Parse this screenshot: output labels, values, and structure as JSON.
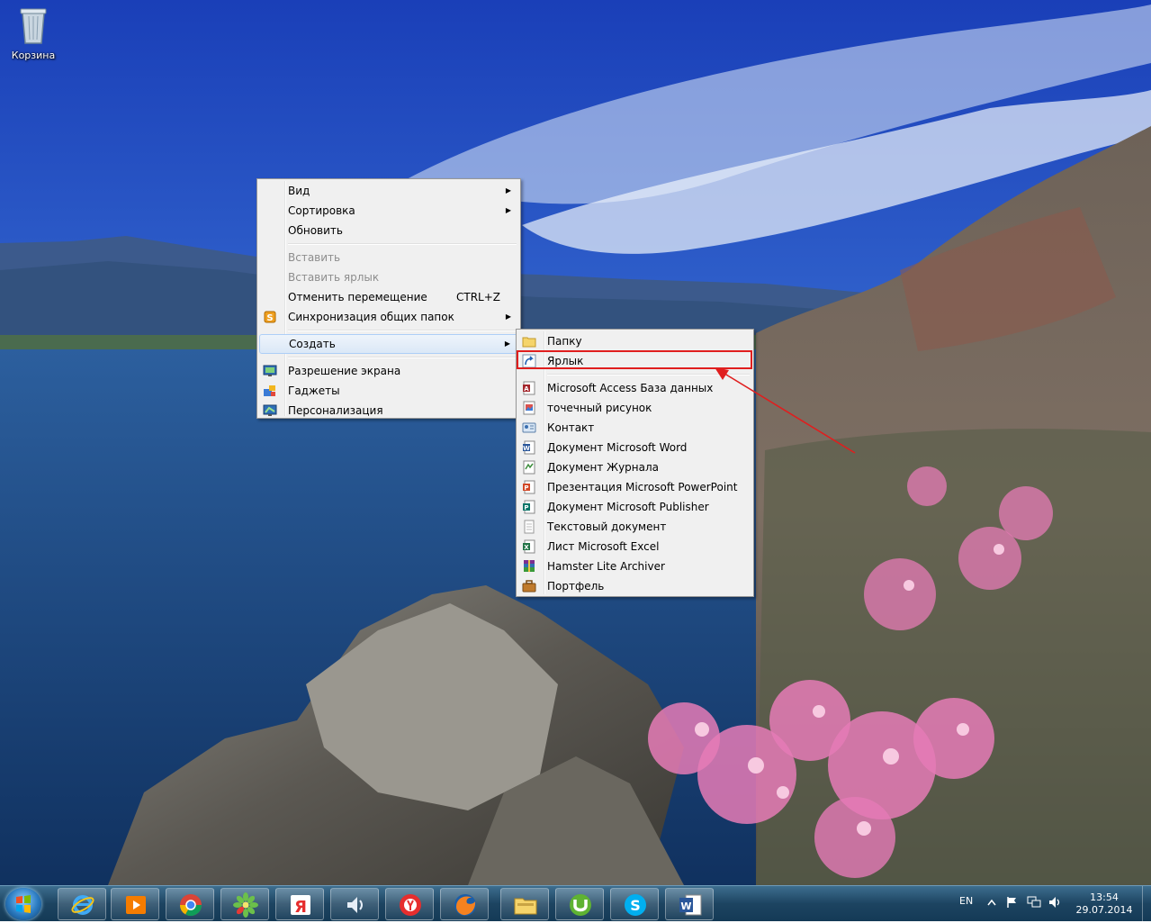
{
  "desktop": {
    "recycle_bin_label": "Корзина"
  },
  "context_menu": {
    "items": [
      {
        "label": "Вид",
        "submenu": true
      },
      {
        "label": "Сортировка",
        "submenu": true
      },
      {
        "label": "Обновить"
      },
      {
        "label": "Вставить",
        "disabled": true
      },
      {
        "label": "Вставить ярлык",
        "disabled": true
      },
      {
        "label": "Отменить перемещение",
        "shortcut": "CTRL+Z"
      },
      {
        "label": "Синхронизация общих папок",
        "submenu": true
      },
      {
        "label": "Создать",
        "submenu": true,
        "highlighted": true
      },
      {
        "label": "Разрешение экрана"
      },
      {
        "label": "Гаджеты"
      },
      {
        "label": "Персонализация"
      }
    ]
  },
  "create_submenu": {
    "items": [
      {
        "label": "Папку",
        "icon": "folder-icon"
      },
      {
        "label": "Ярлык",
        "icon": "shortcut-icon",
        "highlighted_box": true
      },
      {
        "label": "Microsoft Access База данных",
        "icon": "access-icon"
      },
      {
        "label": "точечный рисунок",
        "icon": "bitmap-icon"
      },
      {
        "label": "Контакт",
        "icon": "contact-icon"
      },
      {
        "label": "Документ Microsoft Word",
        "icon": "word-doc-icon"
      },
      {
        "label": "Документ Журнала",
        "icon": "journal-icon"
      },
      {
        "label": "Презентация Microsoft PowerPoint",
        "icon": "powerpoint-icon"
      },
      {
        "label": "Документ Microsoft Publisher",
        "icon": "publisher-icon"
      },
      {
        "label": "Текстовый документ",
        "icon": "text-doc-icon"
      },
      {
        "label": "Лист Microsoft Excel",
        "icon": "excel-icon"
      },
      {
        "label": "Hamster Lite Archiver",
        "icon": "archiver-icon"
      },
      {
        "label": "Портфель",
        "icon": "briefcase-icon"
      }
    ]
  },
  "taskbar": {
    "pinned": [
      "internet-explorer-icon",
      "media-player-icon",
      "chrome-icon",
      "icq-icon",
      "yandex-icon",
      "volume-app-icon",
      "yandex-browser-icon",
      "firefox-icon",
      "explorer-icon",
      "utorrent-icon",
      "skype-icon",
      "word-icon"
    ],
    "language": "EN",
    "time": "13:54",
    "date": "29.07.2014"
  },
  "colors": {
    "menu_bg": "#f0f0f0",
    "highlight_box": "#e01e1e",
    "taskbar": "#1d4461"
  }
}
